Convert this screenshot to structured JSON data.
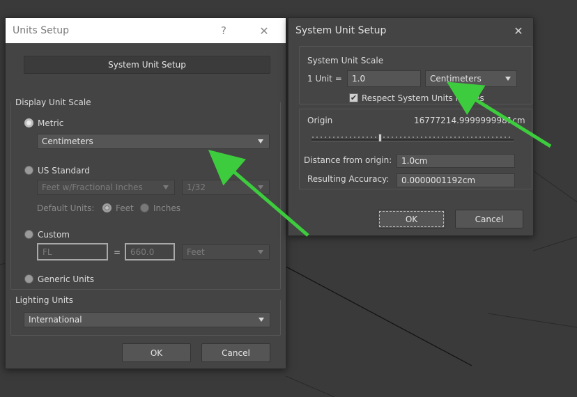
{
  "units_setup": {
    "title": "Units Setup",
    "help_label": "?",
    "close_label": "✕",
    "system_unit_setup_button": "System Unit Setup",
    "display_unit_scale": {
      "heading": "Display Unit Scale",
      "metric_label": "Metric",
      "metric_value": "Centimeters",
      "us_standard_label": "US Standard",
      "us_units_value": "Feet w/Fractional Inches",
      "us_fraction_value": "1/32",
      "default_units_label": "Default Units:",
      "feet_label": "Feet",
      "inches_label": "Inches",
      "custom_label": "Custom",
      "custom_name_value": "FL",
      "equals_label": "=",
      "custom_amount_value": "660.0",
      "custom_units_value": "Feet",
      "generic_label": "Generic Units"
    },
    "lighting_units": {
      "heading": "Lighting Units",
      "value": "International"
    },
    "ok_label": "OK",
    "cancel_label": "Cancel"
  },
  "system_unit_setup": {
    "title": "System Unit Setup",
    "close_label": "✕",
    "scale": {
      "heading": "System Unit Scale",
      "unit_label": "1 Unit =",
      "unit_value": "1.0",
      "units_dropdown": "Centimeters",
      "respect_label": "Respect System Units in Files"
    },
    "origin": {
      "origin_label": "Origin",
      "origin_value": "16777214.9999999981cm",
      "slider_fraction": 0.33,
      "distance_label": "Distance from origin:",
      "distance_value": "1.0cm",
      "accuracy_label": "Resulting Accuracy:",
      "accuracy_value": "0.0000001192cm"
    },
    "ok_label": "OK",
    "cancel_label": "Cancel"
  },
  "colors": {
    "viewport_bg": "#3a3a3a",
    "dialog_bg": "#444444",
    "annotation_arrow": "#3dcc3d"
  }
}
